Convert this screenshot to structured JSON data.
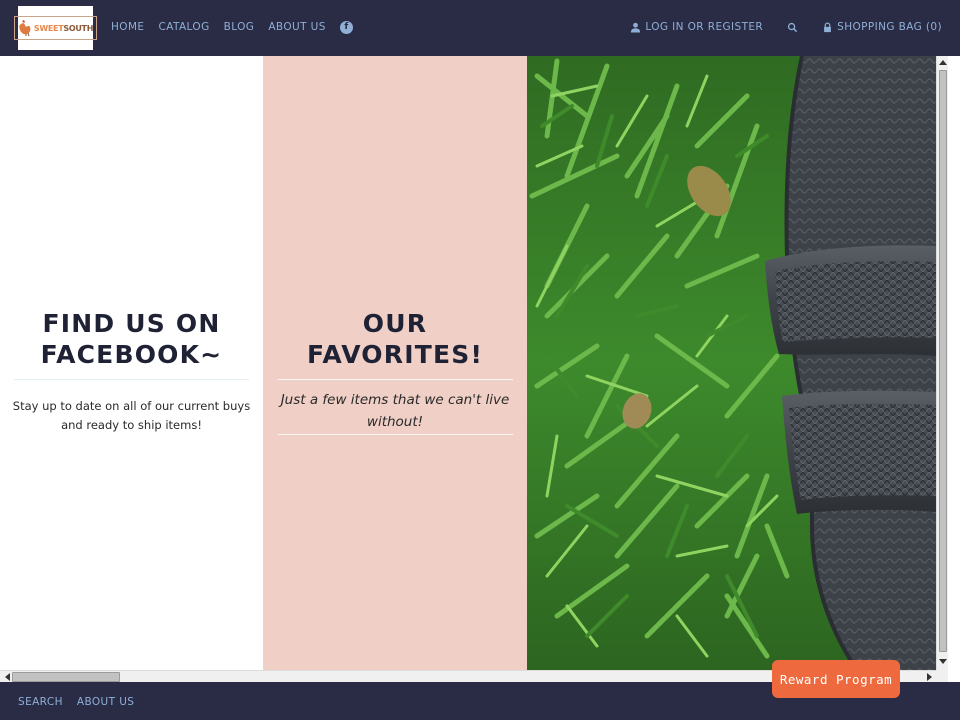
{
  "logo": {
    "text_part1": "SWEET",
    "text_part2": "SOUTH"
  },
  "nav": {
    "items": [
      {
        "label": "HOME"
      },
      {
        "label": "CATALOG"
      },
      {
        "label": "BLOG"
      },
      {
        "label": "ABOUT US"
      }
    ],
    "facebook_glyph": "f",
    "account_label": "LOG IN OR REGISTER",
    "bag_label": "SHOPPING BAG (0)"
  },
  "facebook_section": {
    "title_line1": "FIND US ON",
    "title_line2": "FACEBOOK~",
    "text_line1": "Stay up to date on all of our current buys",
    "text_line2": "and ready to ship items!"
  },
  "favorites_section": {
    "title_line1": "OUR",
    "title_line2": "FAVORITES!",
    "text_line1": "Just a few items that we can't live",
    "text_line2": "without!"
  },
  "footer": {
    "links": [
      {
        "label": "SEARCH"
      },
      {
        "label": "ABOUT US"
      }
    ]
  },
  "reward_button": {
    "label": "Reward Program"
  },
  "colors": {
    "header_bg": "#2a2b45",
    "nav_link": "#8fb0d6",
    "favorites_bg": "#f0cfc6",
    "reward_bg": "#ee6a3e",
    "heading": "#1f2235"
  },
  "icons": {
    "user": "user-icon",
    "search": "search-icon",
    "lock": "lock-icon",
    "facebook": "facebook-icon"
  }
}
